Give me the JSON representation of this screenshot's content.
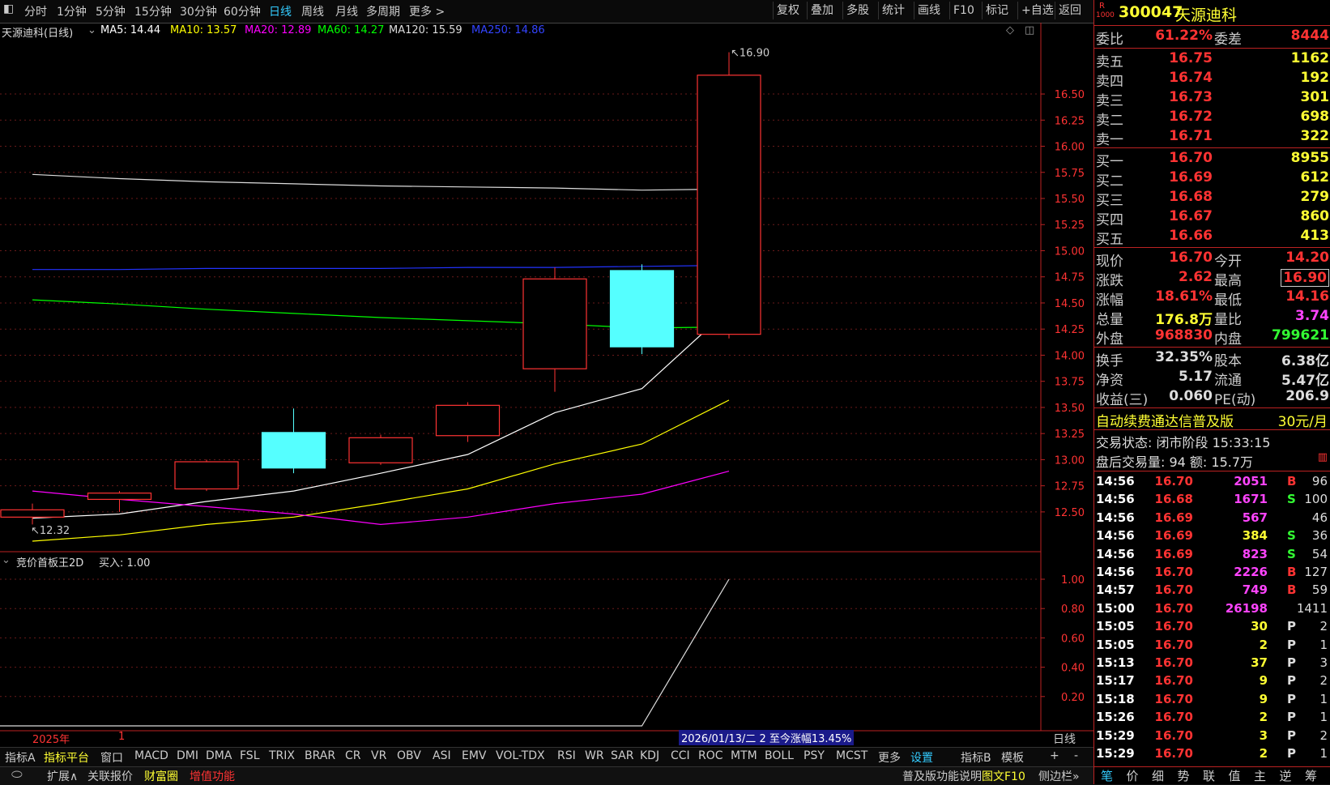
{
  "toolbar": {
    "periods": [
      "分时",
      "1分钟",
      "5分钟",
      "15分钟",
      "30分钟",
      "60分钟",
      "日线",
      "周线",
      "月线",
      "多周期",
      "更多"
    ],
    "active_index": 6,
    "right_buttons": [
      "复权",
      "叠加",
      "多股",
      "统计",
      "画线",
      "F10",
      "标记",
      "+自选",
      "返回"
    ]
  },
  "chart": {
    "title": "天源迪科(日线)",
    "ma_legend": [
      {
        "label": "MA5: 14.44",
        "color": "#ffffff"
      },
      {
        "label": "MA10: 13.57",
        "color": "#ffff00"
      },
      {
        "label": "MA20: 12.89",
        "color": "#ff00ff"
      },
      {
        "label": "MA60: 14.27",
        "color": "#00ff00"
      },
      {
        "label": "MA120: 15.59",
        "color": "#dddddd"
      },
      {
        "label": "MA250: 14.86",
        "color": "#3344ff"
      }
    ],
    "high_label": "16.90",
    "low_label": "12.32",
    "year_label": "2025年",
    "month_label": "1",
    "range_label": "2026/01/13/二 2 至今涨幅13.45%",
    "period_corner": "日线",
    "indicator_title": "竞价首板王2D",
    "indicator_value": "买入: 1.00"
  },
  "chart_data": {
    "type": "candlestick",
    "y_ticks": [
      "16.50",
      "16.25",
      "16.00",
      "15.75",
      "15.50",
      "15.25",
      "15.00",
      "14.75",
      "14.50",
      "14.25",
      "14.00",
      "13.75",
      "13.50",
      "13.25",
      "13.00",
      "12.75",
      "12.50"
    ],
    "y_range": [
      12.22,
      16.95
    ],
    "candles": [
      {
        "open": 12.45,
        "close": 12.52,
        "high": 12.58,
        "low": 12.38,
        "up": true
      },
      {
        "open": 12.62,
        "close": 12.68,
        "high": 12.7,
        "low": 12.5,
        "up": true
      },
      {
        "open": 12.72,
        "close": 12.98,
        "high": 13.0,
        "low": 12.7,
        "up": true
      },
      {
        "open": 13.26,
        "close": 12.92,
        "high": 13.49,
        "low": 12.87,
        "up": false
      },
      {
        "open": 12.97,
        "close": 13.21,
        "high": 13.24,
        "low": 12.95,
        "up": true
      },
      {
        "open": 13.23,
        "close": 13.52,
        "high": 13.55,
        "low": 13.17,
        "up": true
      },
      {
        "open": 13.87,
        "close": 14.73,
        "high": 14.84,
        "low": 13.65,
        "up": true
      },
      {
        "open": 14.81,
        "close": 14.08,
        "high": 14.87,
        "low": 14.01,
        "up": false
      },
      {
        "open": 14.2,
        "close": 16.68,
        "high": 16.9,
        "low": 14.16,
        "up": true
      }
    ],
    "ma_series": [
      {
        "name": "MA5",
        "values": [
          12.44,
          12.48,
          12.6,
          12.7,
          12.87,
          13.05,
          13.45,
          13.68,
          14.44
        ]
      },
      {
        "name": "MA10",
        "values": [
          12.22,
          12.28,
          12.38,
          12.45,
          12.58,
          12.72,
          12.96,
          13.15,
          13.57
        ]
      },
      {
        "name": "MA20",
        "values": [
          12.7,
          12.62,
          12.55,
          12.48,
          12.38,
          12.45,
          12.58,
          12.67,
          12.89
        ]
      },
      {
        "name": "MA60",
        "values": [
          14.53,
          14.49,
          14.44,
          14.4,
          14.36,
          14.33,
          14.3,
          14.26,
          14.27
        ]
      },
      {
        "name": "MA120",
        "values": [
          15.73,
          15.69,
          15.66,
          15.64,
          15.62,
          15.61,
          15.6,
          15.58,
          15.59
        ]
      },
      {
        "name": "MA250",
        "values": [
          14.82,
          14.82,
          14.83,
          14.83,
          14.83,
          14.84,
          14.84,
          14.85,
          14.86
        ]
      }
    ],
    "indicator_ticks": [
      "1.00",
      "0.80",
      "0.60",
      "0.40",
      "0.20"
    ],
    "indicator_values": [
      0,
      0,
      0,
      0,
      0,
      0,
      0,
      0,
      1.0
    ]
  },
  "panel": {
    "badge": "R",
    "badge_sub": "1000",
    "code": "300047",
    "name": "天源迪科",
    "weibi": {
      "label": "委比",
      "value": "61.22%",
      "label2": "委差",
      "value2": "8444"
    },
    "asks": [
      {
        "label": "卖五",
        "price": "16.75",
        "vol": "1162"
      },
      {
        "label": "卖四",
        "price": "16.74",
        "vol": "192"
      },
      {
        "label": "卖三",
        "price": "16.73",
        "vol": "301"
      },
      {
        "label": "卖二",
        "price": "16.72",
        "vol": "698"
      },
      {
        "label": "卖一",
        "price": "16.71",
        "vol": "322"
      }
    ],
    "bids": [
      {
        "label": "买一",
        "price": "16.70",
        "vol": "8955"
      },
      {
        "label": "买二",
        "price": "16.69",
        "vol": "612"
      },
      {
        "label": "买三",
        "price": "16.68",
        "vol": "279"
      },
      {
        "label": "买四",
        "price": "16.67",
        "vol": "860"
      },
      {
        "label": "买五",
        "price": "16.66",
        "vol": "413"
      }
    ],
    "quote": [
      {
        "l1": "现价",
        "v1": "16.70",
        "l2": "今开",
        "v2": "14.20",
        "c2": "#ff3333"
      },
      {
        "l1": "涨跌",
        "v1": "2.62",
        "l2": "最高",
        "v2": "16.90",
        "c2": "#ff3333",
        "box": true
      },
      {
        "l1": "涨幅",
        "v1": "18.61%",
        "l2": "最低",
        "v2": "14.16",
        "c2": "#ff3333"
      },
      {
        "l1": "总量",
        "v1": "176.8万",
        "l2": "量比",
        "v2": "3.74",
        "c1": "#ffff33",
        "c2": "#ff44ff"
      },
      {
        "l1": "外盘",
        "v1": "968830",
        "l2": "内盘",
        "v2": "799621",
        "c2": "#33ff33"
      }
    ],
    "fin": [
      {
        "l1": "换手",
        "v1": "32.35%",
        "l2": "股本",
        "v2": "6.38亿"
      },
      {
        "l1": "净资",
        "v1": "5.17",
        "l2": "流通",
        "v2": "5.47亿"
      },
      {
        "l1": "收益(三)",
        "v1": "0.060",
        "l2": "PE(动)",
        "v2": "206.9"
      }
    ],
    "ad_text": "自动续费通达信普及版",
    "ad_price": "30元/月",
    "trade_status": "交易状态: 闭市阶段 15:33:15",
    "after_hours": "盘后交易量: 94  额: 15.7万",
    "ticks": [
      {
        "t": "14:56",
        "p": "16.70",
        "v": "2051",
        "f": "B",
        "n": "96"
      },
      {
        "t": "14:56",
        "p": "16.68",
        "v": "1671",
        "f": "S",
        "n": "100"
      },
      {
        "t": "14:56",
        "p": "16.69",
        "v": "567",
        "f": "",
        "n": "46"
      },
      {
        "t": "14:56",
        "p": "16.69",
        "v": "384",
        "f": "S",
        "n": "36"
      },
      {
        "t": "14:56",
        "p": "16.69",
        "v": "823",
        "f": "S",
        "n": "54"
      },
      {
        "t": "14:56",
        "p": "16.70",
        "v": "2226",
        "f": "B",
        "n": "127"
      },
      {
        "t": "14:57",
        "p": "16.70",
        "v": "749",
        "f": "B",
        "n": "59"
      },
      {
        "t": "15:00",
        "p": "16.70",
        "v": "26198",
        "f": "",
        "n": "1411"
      },
      {
        "t": "15:05",
        "p": "16.70",
        "v": "30",
        "f": "P",
        "n": "2"
      },
      {
        "t": "15:05",
        "p": "16.70",
        "v": "2",
        "f": "P",
        "n": "1"
      },
      {
        "t": "15:13",
        "p": "16.70",
        "v": "37",
        "f": "P",
        "n": "3"
      },
      {
        "t": "15:17",
        "p": "16.70",
        "v": "9",
        "f": "P",
        "n": "2"
      },
      {
        "t": "15:18",
        "p": "16.70",
        "v": "9",
        "f": "P",
        "n": "1"
      },
      {
        "t": "15:26",
        "p": "16.70",
        "v": "2",
        "f": "P",
        "n": "1"
      },
      {
        "t": "15:29",
        "p": "16.70",
        "v": "3",
        "f": "P",
        "n": "2"
      },
      {
        "t": "15:29",
        "p": "16.70",
        "v": "2",
        "f": "P",
        "n": "1"
      }
    ],
    "tabs": [
      "笔",
      "价",
      "细",
      "势",
      "联",
      "值",
      "主",
      "逆",
      "筹"
    ]
  },
  "indicator_bar": {
    "items": [
      "指标A",
      "指标平台",
      "窗口",
      "MACD",
      "DMI",
      "DMA",
      "FSL",
      "TRIX",
      "BRAR",
      "CR",
      "VR",
      "OBV",
      "ASI",
      "EMV",
      "VOL-TDX",
      "RSI",
      "WR",
      "SAR",
      "KDJ",
      "CCI",
      "ROC",
      "MTM",
      "BOLL",
      "PSY",
      "MCST",
      "更多",
      "设置"
    ],
    "right": [
      "指标B",
      "模板",
      "+",
      "-"
    ]
  },
  "status_bar": {
    "items": [
      "扩展∧",
      "关联报价",
      "财富圈",
      "增值功能"
    ],
    "right": [
      "普及版功能说明",
      "图文F10",
      "侧边栏»"
    ]
  }
}
